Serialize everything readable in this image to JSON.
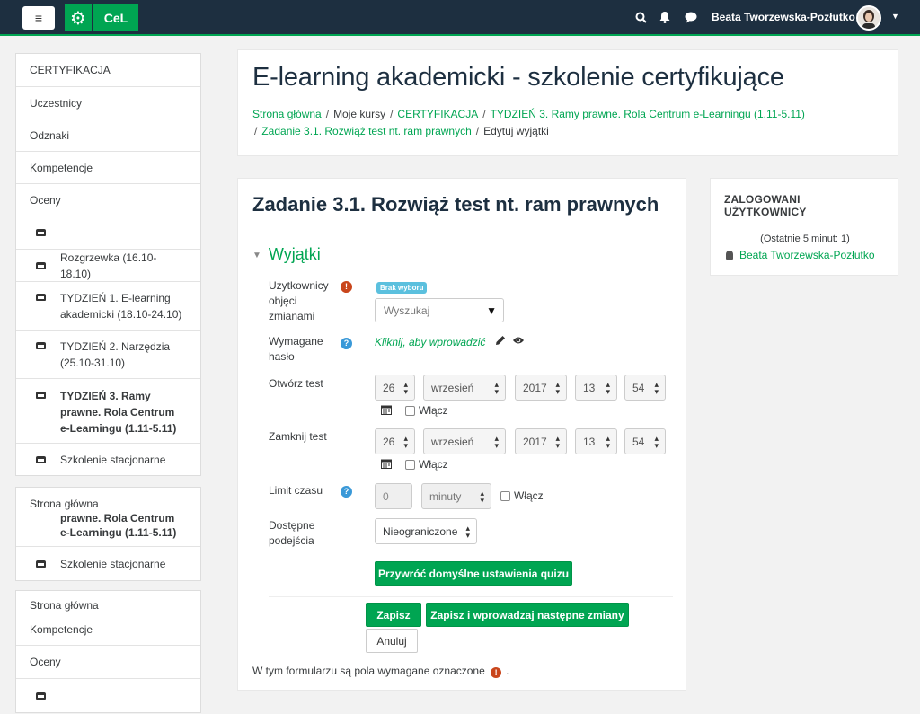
{
  "navbar": {
    "menu_icon": "≡",
    "gear_icon": "⚙",
    "brand": "CeL",
    "user_name": "Beata Tworzewska-Pozłutko",
    "caret": "▼"
  },
  "sidebar": {
    "block1": [
      {
        "label": "CERTYFIKACJA",
        "icon": false
      },
      {
        "label": "Uczestnicy",
        "icon": false
      },
      {
        "label": "Odznaki",
        "icon": false
      },
      {
        "label": "Kompetencje",
        "icon": false
      },
      {
        "label": "Oceny",
        "icon": false
      },
      {
        "label": "",
        "icon": true
      },
      {
        "label": "Rozgrzewka (16.10-18.10)",
        "icon": true
      },
      {
        "label": "TYDZIEŃ 1. E-learning akademicki (18.10-24.10)",
        "icon": true
      },
      {
        "label": "TYDZIEŃ 2. Narzędzia (25.10-31.10)",
        "icon": true
      },
      {
        "label": "TYDZIEŃ 3. Ramy prawne. Rola Centrum e-Learningu (1.11-5.11)",
        "icon": true,
        "bold": true
      },
      {
        "label": "Szkolenie stacjonarne",
        "icon": true
      }
    ],
    "block2": {
      "home": "Strona główna",
      "sub": "prawne. Rola Centrum e-Learningu (1.11-5.11)",
      "item": "Szkolenie stacjonarne"
    },
    "block3": [
      {
        "label": "Strona główna",
        "icon": false
      },
      {
        "label": "Kompetencje",
        "icon": false
      },
      {
        "label": "Oceny",
        "icon": false
      },
      {
        "label": "",
        "icon": true
      }
    ]
  },
  "header": {
    "title": "E-learning akademicki - szkolenie certyfikujące",
    "breadcrumb": [
      {
        "label": "Strona główna",
        "link": true
      },
      {
        "label": "Moje kursy",
        "link": false
      },
      {
        "label": "CERTYFIKACJA",
        "link": true
      },
      {
        "label": "TYDZIEŃ 3. Ramy prawne. Rola Centrum e-Learningu (1.11-5.11)",
        "link": true
      },
      {
        "label": "Zadanie 3.1. Rozwiąż test nt. ram prawnych",
        "link": true
      },
      {
        "label": "Edytuj wyjątki",
        "link": false
      }
    ]
  },
  "form": {
    "title": "Zadanie 3.1. Rozwiąż test nt. ram prawnych",
    "section": "Wyjątki",
    "users_label": "Użytkownicy objęci zmianami",
    "badge": "Brak wyboru",
    "search_placeholder": "Wyszukaj",
    "password_label": "Wymagane hasło",
    "password_link": "Kliknij, aby wprowadzić",
    "open_label": "Otwórz test",
    "close_label": "Zamknij test",
    "open": {
      "day": "26",
      "month": "wrzesień",
      "year": "2017",
      "hour": "13",
      "minute": "54"
    },
    "close": {
      "day": "26",
      "month": "wrzesień",
      "year": "2017",
      "hour": "13",
      "minute": "54"
    },
    "enable_label": "Włącz",
    "time_limit_label": "Limit czasu",
    "time_limit_value": "0",
    "time_unit": "minuty",
    "attempts_label": "Dostępne podejścia",
    "attempts_value": "Nieograniczone",
    "revert_button": "Przywróć domyślne ustawienia quizu",
    "save_button": "Zapisz",
    "save_next_button": "Zapisz i wprowadzaj następne zmiany",
    "cancel_button": "Anuluj",
    "footer_note": "W tym formularzu są pola wymagane oznaczone",
    "footer_dot": "."
  },
  "online_users": {
    "title": "ZALOGOWANI UŻYTKOWNICY",
    "recent": "(Ostatnie 5 minut: 1)",
    "user": "Beata Tworzewska-Pozłutko"
  },
  "colors": {
    "navbar": "#1d2f40",
    "accent": "#00a552",
    "help": "#3a99d8",
    "required": "#c9461c"
  }
}
